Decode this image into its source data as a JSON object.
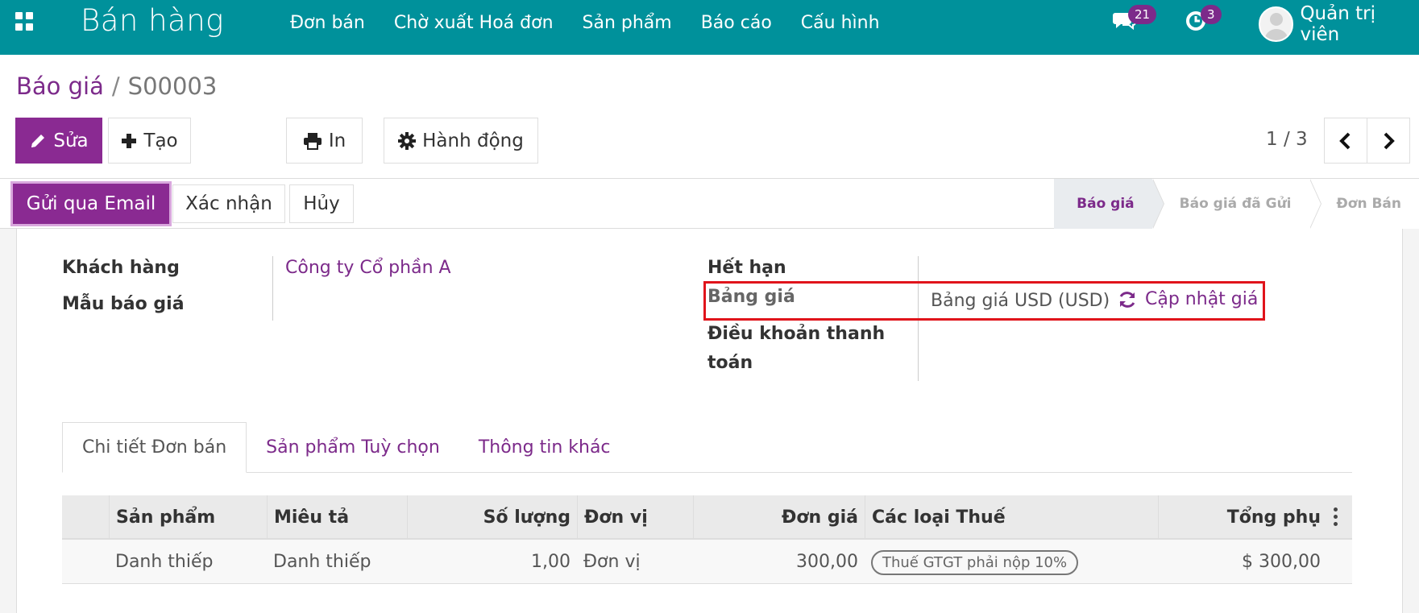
{
  "navbar": {
    "brand": "Bán hàng",
    "menu": [
      "Đơn bán",
      "Chờ xuất Hoá đơn",
      "Sản phẩm",
      "Báo cáo",
      "Cấu hình"
    ],
    "messages_count": "21",
    "activities_count": "3",
    "user_name": "Quản trị viên",
    "color": "#00919b"
  },
  "breadcrumb": {
    "parent": "Báo giá",
    "separator": "/",
    "current": "S00003"
  },
  "toolbar": {
    "edit_label": "Sửa",
    "create_label": "Tạo",
    "print_label": "In",
    "action_label": "Hành động",
    "pager": "1 / 3"
  },
  "statusbar": {
    "email_label": "Gửi qua Email",
    "confirm_label": "Xác nhận",
    "cancel_label": "Hủy",
    "steps": [
      "Báo giá",
      "Báo giá đã Gửi",
      "Đơn Bán"
    ],
    "active_step": "Báo giá"
  },
  "form": {
    "customer_label": "Khách hàng",
    "customer_value": "Công ty Cổ phần A",
    "template_label": "Mẫu báo giá",
    "expiry_label": "Hết hạn",
    "pricelist_label": "Bảng giá",
    "pricelist_value": "Bảng giá USD (USD)",
    "update_prices_label": "Cập nhật giá",
    "payment_terms_label_1": "Điều khoản thanh",
    "payment_terms_label_2": "toán"
  },
  "tabs": [
    "Chi tiết Đơn bán",
    "Sản phẩm Tuỳ chọn",
    "Thông tin khác"
  ],
  "order_lines": {
    "columns": [
      "Sản phẩm",
      "Miêu tả",
      "Số lượng",
      "Đơn vị",
      "Đơn giá",
      "Các loại Thuế",
      "Tổng phụ"
    ],
    "rows": [
      {
        "product": "Danh thiếp",
        "description": "Danh thiếp",
        "quantity": "1,00",
        "uom": "Đơn vị",
        "unit_price": "300,00",
        "tax": "Thuế GTGT phải nộp 10%",
        "subtotal": "$ 300,00"
      }
    ]
  },
  "accent_color": "#7c2a8a"
}
